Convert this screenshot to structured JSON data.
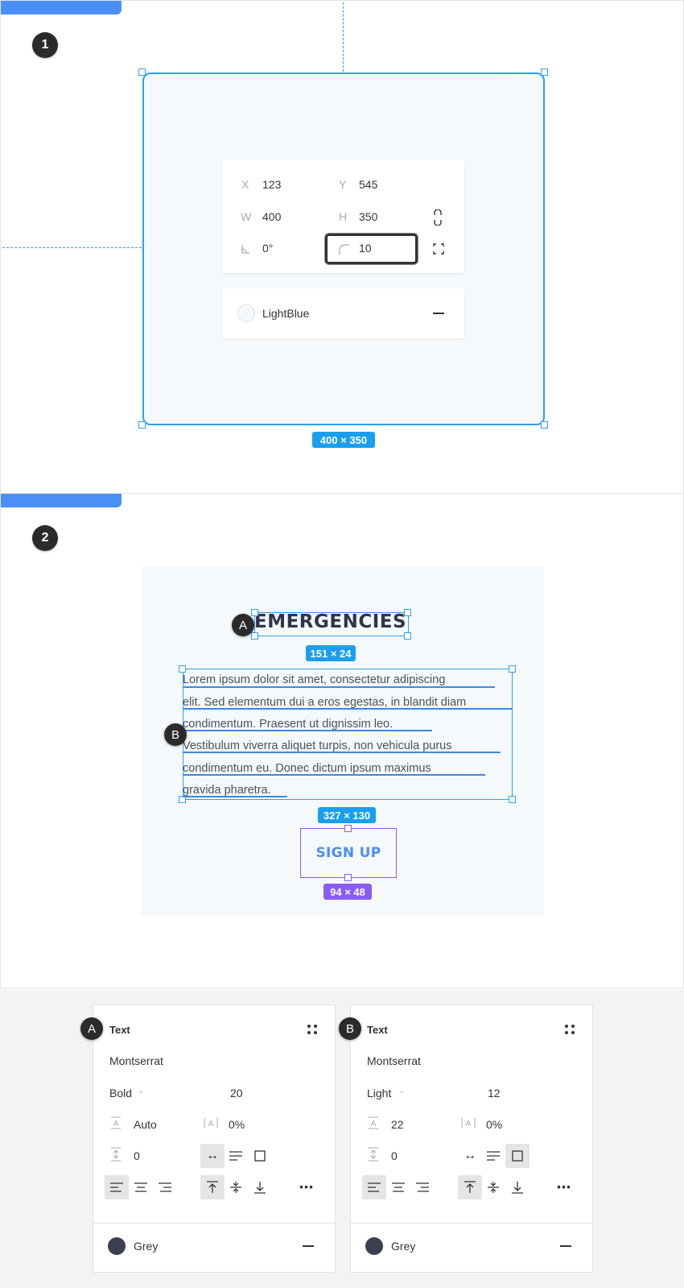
{
  "steps": [
    "1",
    "2"
  ],
  "frame": {
    "props": {
      "x_label": "X",
      "x_value": "123",
      "y_label": "Y",
      "y_value": "545",
      "w_label": "W",
      "w_value": "400",
      "h_label": "H",
      "h_value": "350",
      "rotation_value": "0°",
      "radius_value": "10"
    },
    "fill_name": "LightBlue",
    "size_tag": "400 × 350"
  },
  "artboard": {
    "heading": "EMERGENCIES",
    "heading_size": "151 × 24",
    "body_lines": [
      "Lorem ipsum dolor sit amet, consectetur adipiscing",
      "elit. Sed elementum dui a eros egestas, in blandit diam",
      "condimentum. Praesent ut dignissim leo.",
      "Vestibulum viverra aliquet turpis, non vehicula purus",
      "condimentum eu. Donec dictum ipsum maximus",
      "gravida pharetra."
    ],
    "body_size": "327 × 130",
    "button_label": "SIGN UP",
    "button_size": "94 × 48",
    "markers": [
      "A",
      "B"
    ]
  },
  "text_panels": [
    {
      "marker": "A",
      "title": "Text",
      "font": "Montserrat",
      "weight": "Bold",
      "size": "20",
      "line_height": "Auto",
      "letter_spacing": "0%",
      "paragraph_spacing": "0",
      "resize_active": "auto-width",
      "color_name": "Grey",
      "color": "#3b3f52"
    },
    {
      "marker": "B",
      "title": "Text",
      "font": "Montserrat",
      "weight": "Light",
      "size": "12",
      "line_height": "22",
      "letter_spacing": "0%",
      "paragraph_spacing": "0",
      "resize_active": "fixed",
      "color_name": "Grey",
      "color": "#3b3f52"
    }
  ],
  "colors": {
    "accent": "#2f9ff0",
    "tab": "#4a8ff7",
    "purple": "#8a5cf6"
  }
}
